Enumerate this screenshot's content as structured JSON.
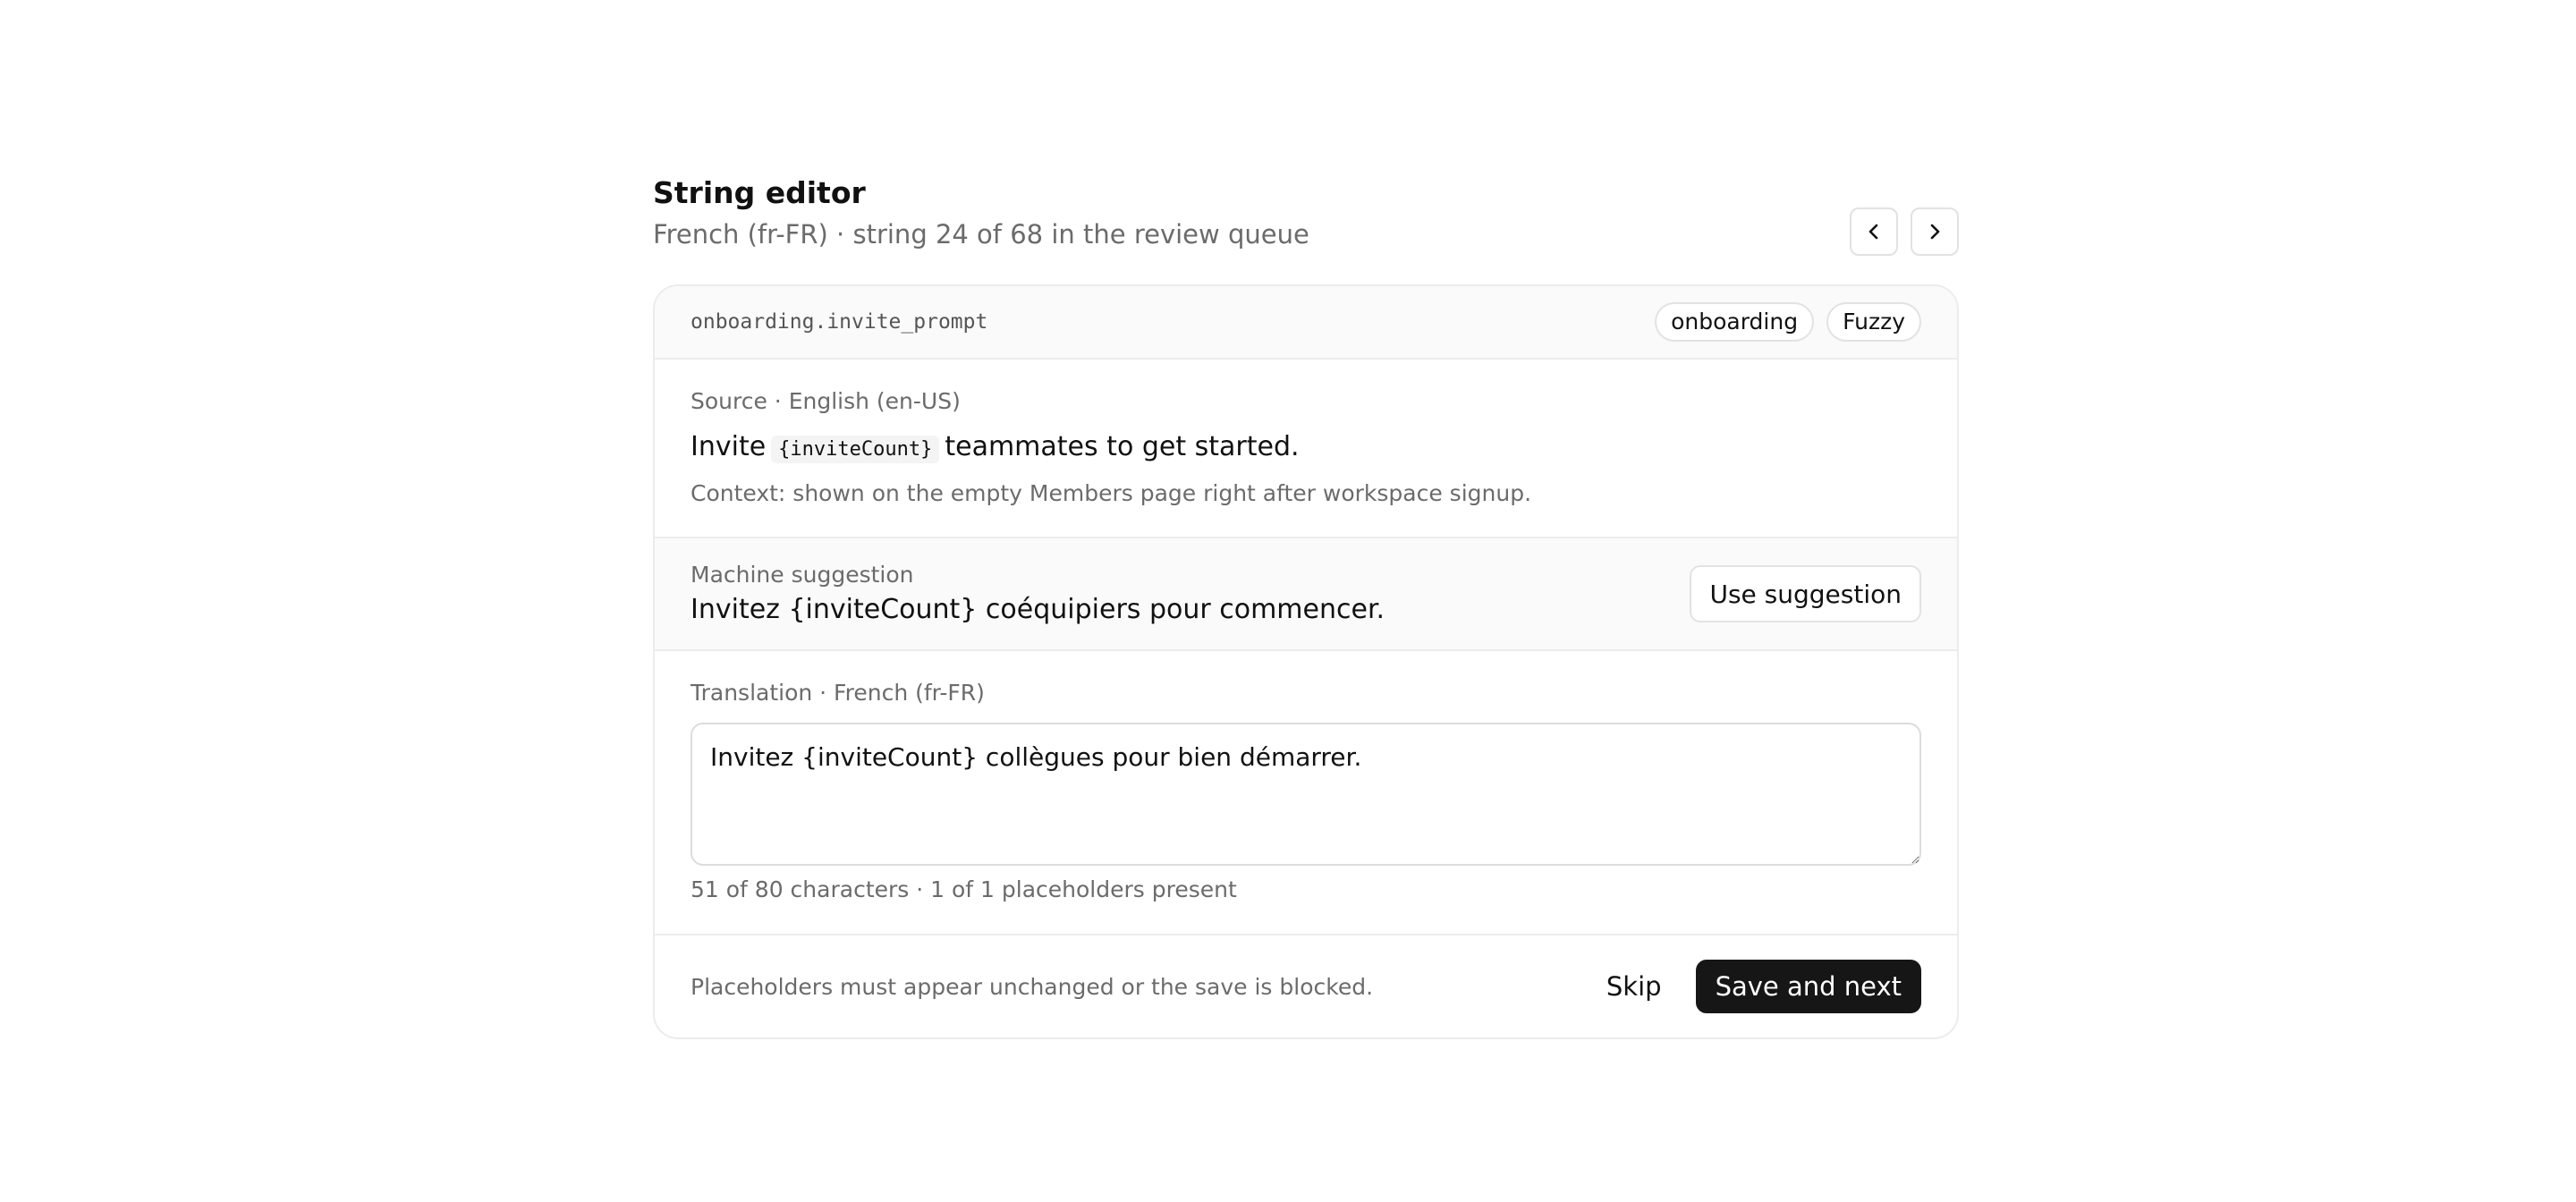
{
  "header": {
    "title": "String editor",
    "subtitle": "French (fr-FR) · string 24 of 68 in the review queue",
    "prev_icon": "chevron-left-icon",
    "next_icon": "chevron-right-icon"
  },
  "string": {
    "key": "onboarding.invite_prompt",
    "tags": [
      "onboarding",
      "Fuzzy"
    ]
  },
  "source": {
    "label": "Source · English (en-US)",
    "text_before": "Invite",
    "placeholder": "{inviteCount}",
    "text_after": "teammates to get started.",
    "context": "Context: shown on the empty Members page right after workspace signup."
  },
  "machine": {
    "label": "Machine suggestion",
    "text": "Invitez {inviteCount} coéquipiers pour commencer.",
    "use_button": "Use suggestion"
  },
  "translation": {
    "label": "Translation · French (fr-FR)",
    "value": "Invitez {inviteCount} collègues pour bien démarrer.",
    "counter": "51 of 80 characters · 1 of 1 placeholders present"
  },
  "footer": {
    "note": "Placeholders must appear unchanged or the save is blocked.",
    "skip_label": "Skip",
    "save_label": "Save and next"
  },
  "colors": {
    "primary_button": "#161616",
    "border": "#ececec",
    "muted_text": "#6b6b6b",
    "section_bg": "#fafafa"
  }
}
